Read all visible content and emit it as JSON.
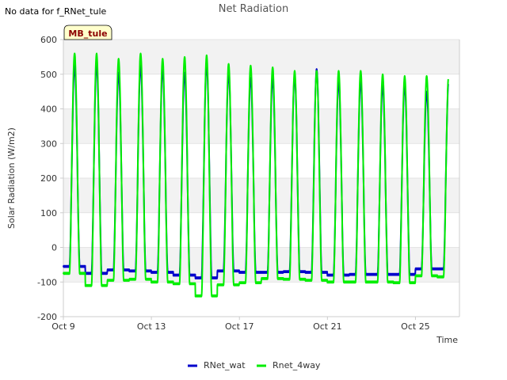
{
  "header": {
    "no_data_note": "No data for f_RNet_tule",
    "site_badge": "MB_tule"
  },
  "colors": {
    "background": "#ffffff",
    "band": "#f2f2f2",
    "grid": "#dddddd",
    "axis": "#cccccc",
    "badge_fill": "#ffffcc",
    "badge_text": "#8b0000"
  },
  "chart_data": {
    "type": "line",
    "title": "Net Radiation",
    "xlabel": "Time",
    "ylabel": "Solar Radiation (W/m2)",
    "ylim": [
      -200,
      600
    ],
    "yticks": [
      -200,
      -100,
      0,
      100,
      200,
      300,
      400,
      500,
      600
    ],
    "xlim": [
      "2023-10-09",
      "2023-10-27"
    ],
    "xticks": [
      {
        "date": "2023-10-09",
        "label": "Oct 9"
      },
      {
        "date": "2023-10-13",
        "label": "Oct 13"
      },
      {
        "date": "2023-10-17",
        "label": "Oct 17"
      },
      {
        "date": "2023-10-21",
        "label": "Oct 21"
      },
      {
        "date": "2023-10-25",
        "label": "Oct 25"
      }
    ],
    "grid": true,
    "legend_position": "bottom-center",
    "series": [
      {
        "name": "RNet_wat",
        "color": "#0000cc",
        "data_start": "2023-10-09",
        "data_end": "2023-10-26.5",
        "daily_peak_dates": [
          "2023-10-09",
          "2023-10-10",
          "2023-10-11",
          "2023-10-12",
          "2023-10-13",
          "2023-10-14",
          "2023-10-15",
          "2023-10-16",
          "2023-10-17",
          "2023-10-18",
          "2023-10-19",
          "2023-10-20",
          "2023-10-21",
          "2023-10-22",
          "2023-10-23",
          "2023-10-24",
          "2023-10-25",
          "2023-10-26"
        ],
        "daily_peak": [
          525,
          530,
          505,
          525,
          515,
          505,
          530,
          505,
          490,
          490,
          495,
          515,
          480,
          480,
          470,
          470,
          450,
          480
        ],
        "night_value": [
          -55,
          -75,
          -65,
          -68,
          -72,
          -80,
          -88,
          -68,
          -72,
          -72,
          -70,
          -72,
          -80,
          -78,
          -78,
          -78,
          -62,
          -62
        ]
      },
      {
        "name": "Rnet_4way",
        "color": "#00ee00",
        "data_start": "2023-10-09",
        "data_end": "2023-10-26.5",
        "daily_peak_dates": [
          "2023-10-09",
          "2023-10-10",
          "2023-10-11",
          "2023-10-12",
          "2023-10-13",
          "2023-10-14",
          "2023-10-15",
          "2023-10-16",
          "2023-10-17",
          "2023-10-18",
          "2023-10-19",
          "2023-10-20",
          "2023-10-21",
          "2023-10-22",
          "2023-10-23",
          "2023-10-24",
          "2023-10-25",
          "2023-10-26"
        ],
        "daily_peak": [
          560,
          560,
          545,
          560,
          545,
          550,
          555,
          530,
          525,
          520,
          510,
          510,
          510,
          510,
          500,
          495,
          495,
          495
        ],
        "night_value": [
          -75,
          -110,
          -95,
          -92,
          -100,
          -105,
          -140,
          -108,
          -102,
          -90,
          -92,
          -95,
          -100,
          -100,
          -100,
          -102,
          -82,
          -85
        ]
      }
    ]
  }
}
